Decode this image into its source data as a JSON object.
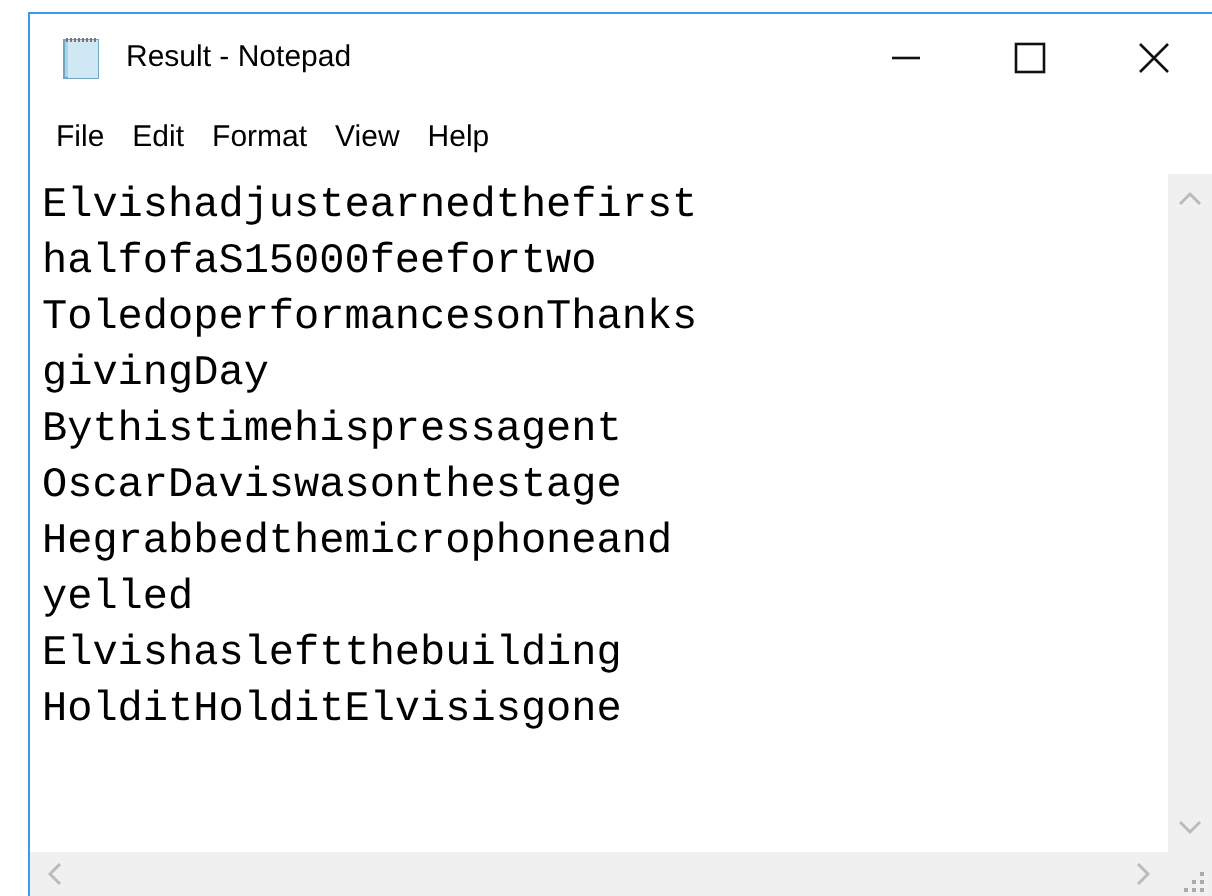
{
  "window": {
    "title": "Result - Notepad"
  },
  "menu": [
    "File",
    "Edit",
    "Format",
    "View",
    "Help"
  ],
  "document": {
    "lines": [
      "Elvishadjustearnedthefirst",
      "halfofaS15000feefortwo",
      "ToledoperformancesonThanks",
      "givingDay",
      "Bythistimehispressagent",
      "OscarDaviswasonthestage",
      "Hegrabbedthemicrophoneand",
      "yelled",
      "Elvishasleftthebuilding",
      "HolditHolditElvisisgone"
    ]
  }
}
